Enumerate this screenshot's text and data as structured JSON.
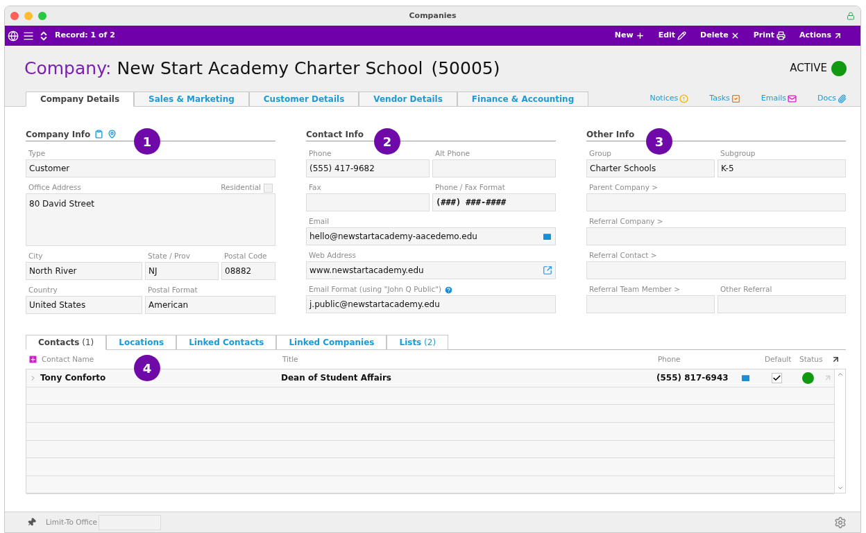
{
  "window": {
    "title": "Companies"
  },
  "toolbar": {
    "record": "Record: 1 of 2",
    "actions": [
      {
        "label": "New"
      },
      {
        "label": "Edit"
      },
      {
        "label": "Delete"
      },
      {
        "label": "Print"
      },
      {
        "label": "Actions"
      }
    ]
  },
  "header": {
    "prefix": "Company:",
    "name": "New Start Academy Charter School",
    "number": "(50005)",
    "status": {
      "label": "ACTIVE",
      "color": "#119911"
    }
  },
  "tabs": [
    {
      "label": "Company Details",
      "selected": true
    },
    {
      "label": "Sales & Marketing",
      "selected": false
    },
    {
      "label": "Customer Details",
      "selected": false
    },
    {
      "label": "Vendor Details",
      "selected": false
    },
    {
      "label": "Finance & Accounting",
      "selected": false
    }
  ],
  "side_links": [
    {
      "label": "Notices"
    },
    {
      "label": "Tasks"
    },
    {
      "label": "Emails"
    },
    {
      "label": "Docs"
    }
  ],
  "sections": [
    {
      "title": "Company Info",
      "callout": "1",
      "rows": [
        [
          {
            "label": "Type",
            "value": "Customer",
            "kind": "text"
          }
        ],
        [
          {
            "label": "Office Address",
            "value": "80 David Street",
            "kind": "multiline",
            "checkbox": {
              "label": "Residential",
              "checked": false
            }
          }
        ],
        [
          {
            "label": "City",
            "value": "North River",
            "kind": "text"
          },
          {
            "label": "State / Prov",
            "value": "NJ",
            "kind": "text"
          },
          {
            "label": "Postal Code",
            "value": "08882",
            "kind": "text"
          }
        ],
        [
          {
            "label": "Country",
            "value": "United States",
            "kind": "text"
          },
          {
            "label": "Postal Format",
            "value": "American",
            "kind": "text"
          }
        ]
      ]
    },
    {
      "title": "Contact Info",
      "callout": "2",
      "rows": [
        [
          {
            "label": "Phone",
            "value": "(555) 417-9682",
            "kind": "text"
          },
          {
            "label": "Alt Phone",
            "kind": "text"
          }
        ],
        [
          {
            "label": "Fax",
            "kind": "text"
          },
          {
            "label": "Phone / Fax Format",
            "value": "(###) ###-####",
            "kind": "format"
          }
        ],
        [
          {
            "label": "Email",
            "value": "hello@newstartacademy-aacedemo.edu",
            "kind": "email"
          }
        ],
        [
          {
            "label": "Web Address",
            "value": "www.newstartacademy.edu",
            "kind": "url"
          }
        ],
        [
          {
            "label": "Email Format (using \"John Q Public\")",
            "value": "j.public@newstartacademy.edu",
            "kind": "text",
            "help": true
          }
        ]
      ]
    },
    {
      "title": "Other Info",
      "callout": "3",
      "rows": [
        [
          {
            "label": "Group",
            "value": "Charter Schools",
            "kind": "text"
          },
          {
            "label": "Subgroup",
            "value": "K-5",
            "kind": "text"
          }
        ],
        [
          {
            "label": "Parent Company >",
            "kind": "text"
          }
        ],
        [
          {
            "label": "Referral Company >",
            "kind": "text"
          }
        ],
        [
          {
            "label": "Referral Contact >",
            "kind": "text"
          }
        ],
        [
          {
            "label": "Referral Team Member >",
            "kind": "text"
          },
          {
            "label": "Other Referral",
            "kind": "text"
          }
        ]
      ]
    }
  ],
  "lower_tabs": [
    {
      "label": "Contacts",
      "count": "(1)",
      "selected": true
    },
    {
      "label": "Locations",
      "selected": false
    },
    {
      "label": "Linked Contacts",
      "selected": false
    },
    {
      "label": "Linked Companies",
      "selected": false
    },
    {
      "label": "Lists",
      "count": "(2)",
      "selected": false
    }
  ],
  "contacts": {
    "callout": "4",
    "columns": [
      "Contact Name",
      "Title",
      "Phone",
      "Default",
      "Status"
    ],
    "rows": [
      {
        "name": "Tony Conforto",
        "title": "Dean of Student Affairs",
        "phone": "(555) 817-6943",
        "default": true,
        "color": "#119911"
      }
    ]
  },
  "footer": {
    "label": "Limit-To Office"
  }
}
